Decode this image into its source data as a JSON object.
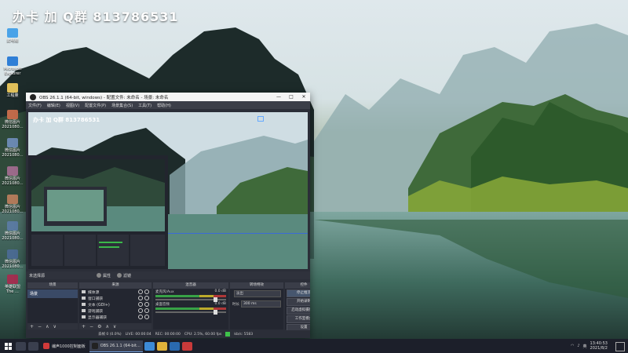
{
  "watermark": "办卡 加 Q群 813786531",
  "desktop_icons": [
    {
      "label": "此电脑",
      "color": "#4aa3e8"
    },
    {
      "label": "Microsoft Explorer",
      "color": "#2f7fd6"
    },
    {
      "label": "工程量",
      "color": "#e0c05a"
    },
    {
      "label": "微信图片 2021080…",
      "color": "#c06a4a"
    },
    {
      "label": "微信图片 2021080…",
      "color": "#6a88b0"
    },
    {
      "label": "微信图片 2021080…",
      "color": "#9a6a8a"
    },
    {
      "label": "微信图片 2021080…",
      "color": "#b07a5a"
    },
    {
      "label": "微信图片 2021080…",
      "color": "#5a7aa0"
    },
    {
      "label": "微信图片 2021080…",
      "color": "#4a6a90"
    },
    {
      "label": "英雄联盟 The …",
      "color": "#a03050"
    }
  ],
  "obs": {
    "title": "OBS 26.1.1 (64-bit, windows) - 配置文件: 未命名 - 场景: 未命名",
    "minimize_icon": "—",
    "maximize_icon": "□",
    "close_icon": "✕",
    "menu": [
      "文件(F)",
      "编辑(E)",
      "视图(V)",
      "配置文件(P)",
      "场景集合(S)",
      "工具(T)",
      "帮助(H)"
    ],
    "preview_watermark": "办卡 加 Q群 813786531",
    "toolbar": {
      "no_source": "未选择源",
      "properties": "属性",
      "filters": "滤镜"
    },
    "docks": {
      "scenes": {
        "title": "场景",
        "items": [
          "场景"
        ]
      },
      "sources": {
        "title": "来源",
        "items": [
          "媒体源",
          "窗口捕获",
          "文本 (GDI+)",
          "游戏捕获",
          "显示器捕获"
        ]
      },
      "mixer": {
        "title": "混音器",
        "channels": [
          {
            "name": "麦克风/Aux",
            "db": "0.0 dB"
          },
          {
            "name": "桌面音频",
            "db": "0.0 dB"
          }
        ]
      },
      "transitions": {
        "title": "转场特效",
        "type": "淡出",
        "duration_label": "时长",
        "duration": "300 ms"
      },
      "controls": {
        "title": "控件",
        "buttons": [
          "停止推流",
          "开始录制",
          "启动虚拟摄像机",
          "工作室模式",
          "设置",
          "退出"
        ]
      }
    },
    "status": {
      "dropped": "丢帧 0 (0.0%)",
      "live": "LIVE: 00:00:04",
      "rec": "REC: 00:00:00",
      "cpu": "CPU: 2.5%, 60.00 fps",
      "kbps": "kb/s: 5583"
    }
  },
  "taskbar": {
    "apps": [
      {
        "label": "编声1000控制面板",
        "color": "#d03a3a",
        "active": false
      },
      {
        "label": "OBS 26.1.1 (64-bit…",
        "color": "#222222",
        "active": true
      }
    ],
    "tray": {
      "ime": "英",
      "time": "13:40:53",
      "date": "2021/8/2"
    }
  }
}
